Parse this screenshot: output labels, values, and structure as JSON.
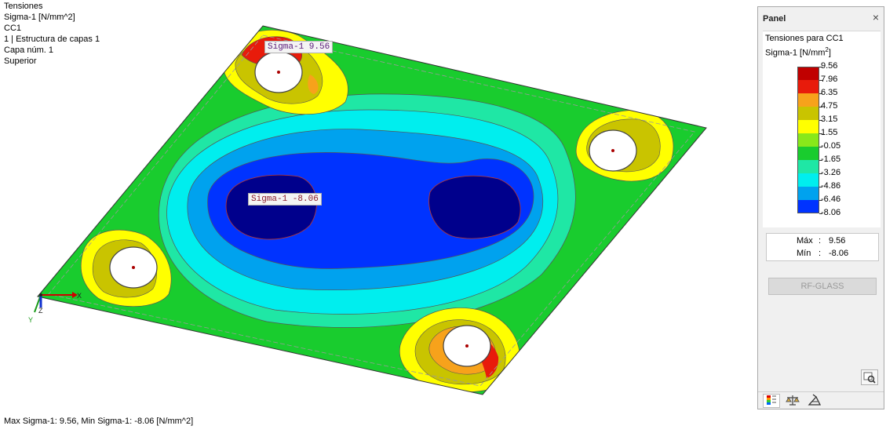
{
  "info": {
    "lines": [
      "Tensiones",
      "Sigma-1 [N/mm^2]",
      "CC1",
      "1 | Estructura de capas 1",
      "Capa núm. 1",
      "Superior"
    ]
  },
  "tags": {
    "max": "Sigma-1  9.56",
    "min": "Sigma-1  -8.06"
  },
  "axes": {
    "x": "X",
    "y": "Y",
    "z": "Z"
  },
  "status": "Max Sigma-1: 9.56, Min Sigma-1: -8.06 [N/mm^2]",
  "panel": {
    "title": "Panel",
    "close": "×",
    "heading": "Tensiones para CC1",
    "unit_prefix": "Sigma-1 [N/mm",
    "unit_sup": "2",
    "unit_suffix": "]",
    "legend": [
      {
        "value": "9.56",
        "color": "#c00000"
      },
      {
        "value": "7.96",
        "color": "#e81b0b"
      },
      {
        "value": "6.35",
        "color": "#f7a21b"
      },
      {
        "value": "4.75",
        "color": "#c9c400"
      },
      {
        "value": "3.15",
        "color": "#ffff00"
      },
      {
        "value": "1.55",
        "color": "#88e81a"
      },
      {
        "value": "-0.05",
        "color": "#19cc2e"
      },
      {
        "value": "-1.65",
        "color": "#1fe7a5"
      },
      {
        "value": "-3.26",
        "color": "#00eeee"
      },
      {
        "value": "-4.86",
        "color": "#00a2ee"
      },
      {
        "value": "-6.46",
        "color": "#0033ff"
      },
      {
        "value": "-8.06",
        "color": "#00008c"
      }
    ],
    "max_label": "Máx",
    "min_label": "Mín",
    "colon": ":",
    "max_value": "9.56",
    "min_value": "-8.06",
    "button": "RF-GLASS",
    "tabs": [
      "color-scale-icon",
      "balance-icon",
      "result-filter-icon"
    ]
  }
}
